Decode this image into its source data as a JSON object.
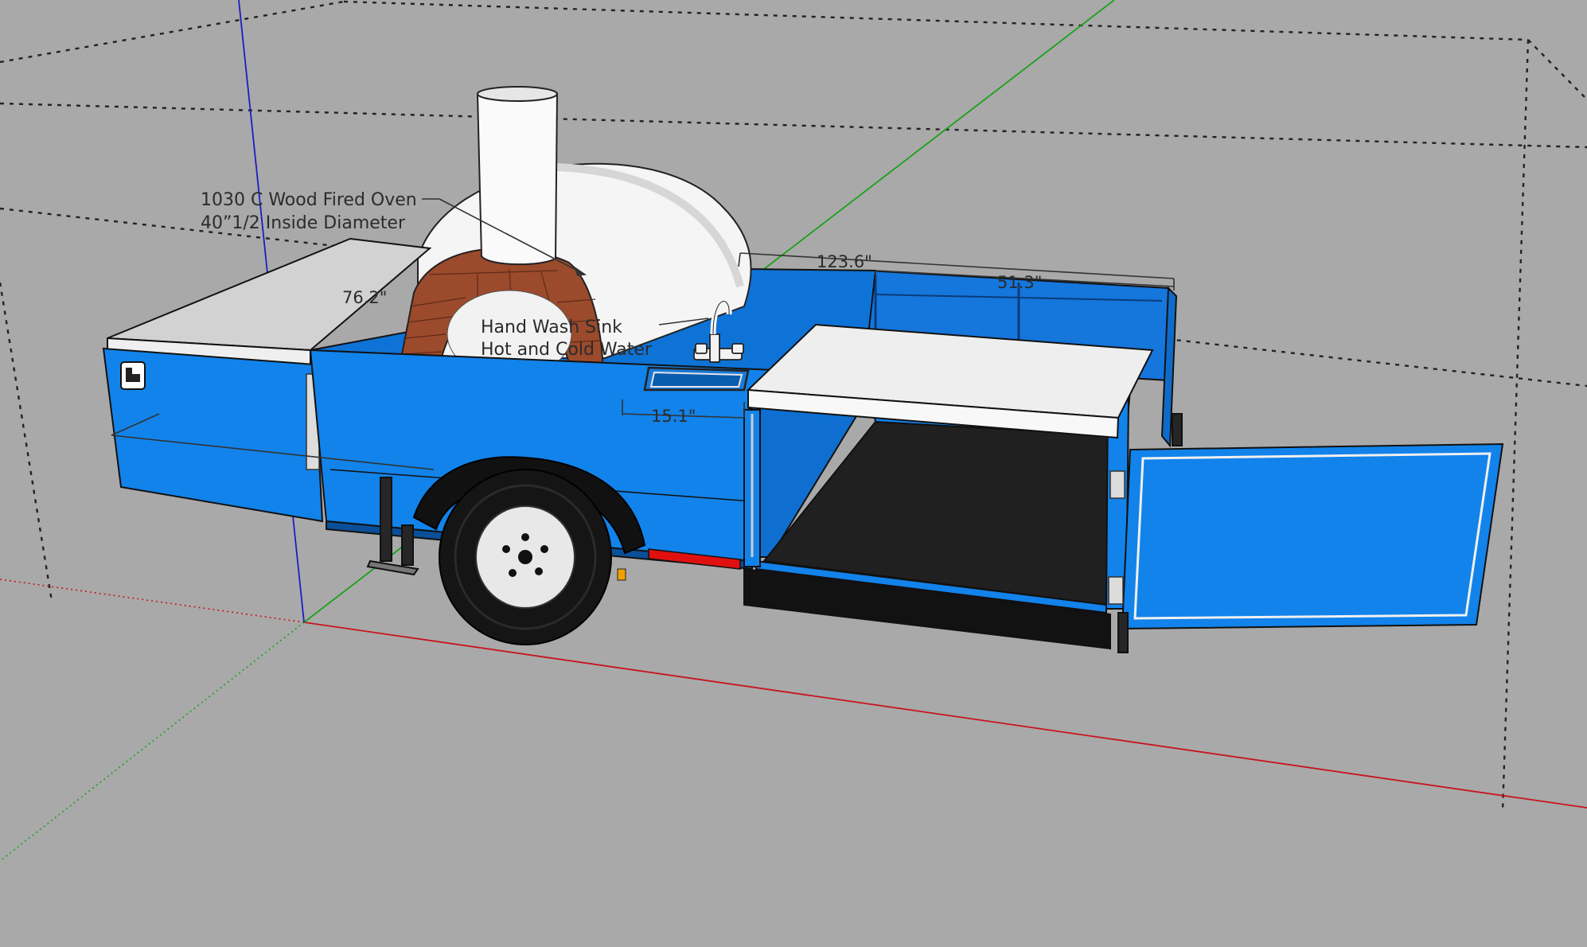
{
  "viewport": {
    "background": "#a9a9a9",
    "axis_colors": {
      "red": "#c8141e",
      "green": "#1aa11a",
      "blue": "#1c1cc4"
    }
  },
  "trailer": {
    "body_color": "#1283ea",
    "floor_color": "#202020",
    "counter_color": "#f0f0f0",
    "fender_color": "#111111",
    "tire_color": "#151515",
    "rim_color": "#e8e8e8",
    "reflector_color": "#e01010",
    "logo_icon": "tool-box-logo-icon"
  },
  "oven": {
    "dome_color": "#f5f5f5",
    "brick_color": "#9b4a2c",
    "chimney_color": "#fafafa"
  },
  "annotations": {
    "oven_line1": "1030 C Wood Fired Oven",
    "oven_line2": "40”1/2 Inside Diameter",
    "sink_line1": "Hand Wash Sink",
    "sink_line2": "Hot and Cold Water"
  },
  "dimensions": {
    "overall_length": "123.6\"",
    "compartment_width": "51.3\"",
    "side_depth": "76.2\"",
    "sink_width": "15.1\""
  }
}
